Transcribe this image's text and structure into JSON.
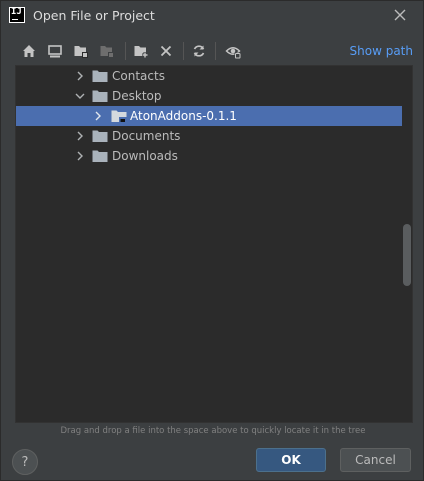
{
  "window": {
    "title": "Open File or Project",
    "app_icon_text": "IJ"
  },
  "toolbar": {
    "buttons": [
      {
        "icon": "home-icon"
      },
      {
        "icon": "desktop-icon"
      },
      {
        "icon": "project-folder-icon"
      },
      {
        "icon": "module-folder-icon",
        "disabled": true
      },
      {
        "icon": "new-folder-icon"
      },
      {
        "icon": "delete-icon"
      },
      {
        "icon": "refresh-icon"
      },
      {
        "icon": "hidden-files-icon"
      }
    ],
    "show_path_label": "Show path"
  },
  "tree": {
    "items": [
      {
        "label": "Contacts",
        "expanded": false,
        "level": 0
      },
      {
        "label": "Desktop",
        "expanded": true,
        "level": 0
      },
      {
        "label": "AtonAddons-0.1.1",
        "expanded": false,
        "level": 1,
        "selected": true
      },
      {
        "label": "Documents",
        "expanded": false,
        "level": 0
      },
      {
        "label": "Downloads",
        "expanded": false,
        "level": 0
      }
    ]
  },
  "footer": {
    "hint": "Drag and drop a file into the space above to quickly locate it in the tree",
    "help_label": "?",
    "ok_label": "OK",
    "cancel_label": "Cancel"
  },
  "colors": {
    "background": "#3c3f41",
    "tree_background": "#2b2b2b",
    "selection": "#4b6eaf",
    "link": "#589df6",
    "ok_button": "#365880"
  }
}
